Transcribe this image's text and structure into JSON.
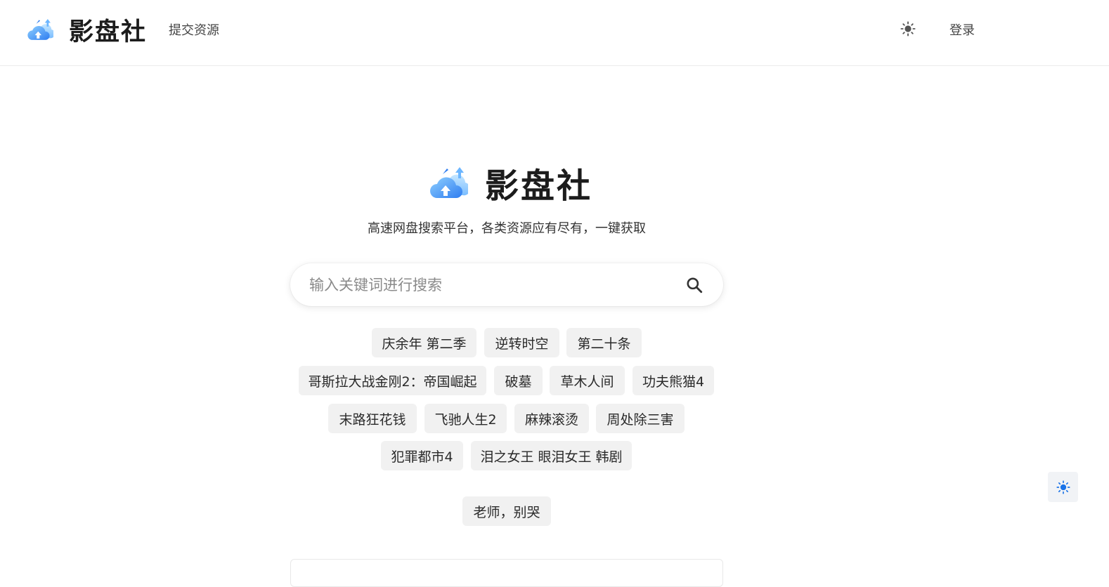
{
  "header": {
    "brand_name": "影盘社",
    "submit_link": "提交资源",
    "login_link": "登录"
  },
  "hero": {
    "title": "影盘社",
    "tagline": "高速网盘搜索平台，各类资源应有尽有，一键获取"
  },
  "search": {
    "placeholder": "输入关键词进行搜索",
    "value": ""
  },
  "hot_tags": [
    "庆余年 第二季",
    "逆转时空",
    "第二十条",
    "哥斯拉大战金刚2：帝国崛起",
    "破墓",
    "草木人间",
    "功夫熊猫4",
    "末路狂花钱",
    "飞驰人生2",
    "麻辣滚烫",
    "周处除三害",
    "犯罪都市4",
    "泪之女王 眼泪女王 韩剧",
    "老师，别哭"
  ],
  "colors": {
    "accent": "#1a73e8",
    "logo_blue": "#2f8cf0",
    "tag_bg": "#f1f1f1",
    "text": "#222222"
  },
  "icons": {
    "brand": "cloud-upload-logo-icon",
    "theme": "sun-icon",
    "search": "search-icon",
    "float_theme": "sun-icon"
  }
}
